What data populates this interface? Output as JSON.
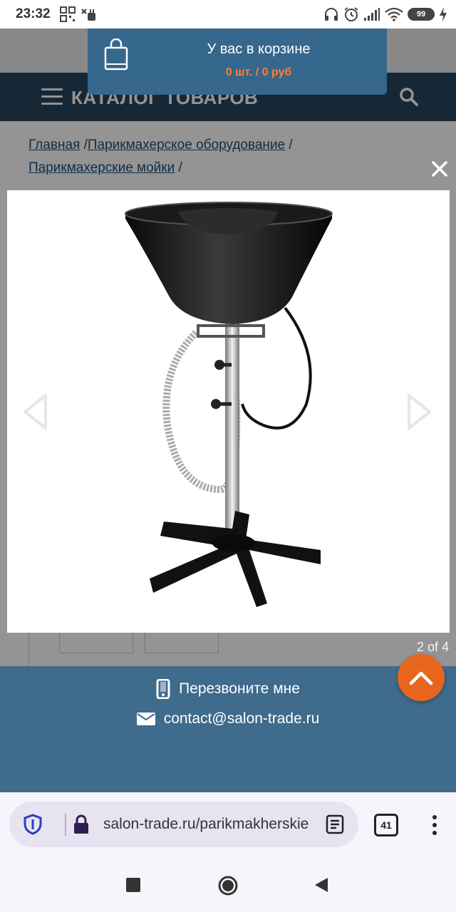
{
  "status_bar": {
    "time": "23:32",
    "battery": "99",
    "icons": [
      "qr-icon",
      "cake-icon",
      "headphones-icon",
      "alarm-icon",
      "signal-icon",
      "wifi-icon",
      "battery-icon",
      "charging-icon"
    ]
  },
  "cart_popup": {
    "title": "У вас в корзине",
    "summary": "0 шт. / 0 руб",
    "icon": "shopping-bag-icon"
  },
  "catalog_bar": {
    "title": "КАТАЛОГ ТОВАРОВ"
  },
  "breadcrumbs": {
    "items": [
      "Главная",
      "Парикмахерское оборудование",
      "Парикмахерские мойки"
    ],
    "separator": "/"
  },
  "lightbox": {
    "counter": "2 of 4",
    "image_alt": "Парикмахерская мойка на подставке",
    "close_icon": "close-icon",
    "prev_icon": "chevron-left-icon",
    "next_icon": "chevron-right-icon"
  },
  "contact": {
    "phone_label": "Перезвоните мне",
    "email": "contact@salon-trade.ru"
  },
  "browser": {
    "url": "salon-trade.ru/parikmakherskie",
    "tab_count": "41"
  },
  "colors": {
    "catalog_bar": "#27465e",
    "cart_popup": "#36678c",
    "cart_summary": "#ff7e35",
    "contact_band": "#3f6b8c",
    "scroll_top": "#e8651e"
  }
}
